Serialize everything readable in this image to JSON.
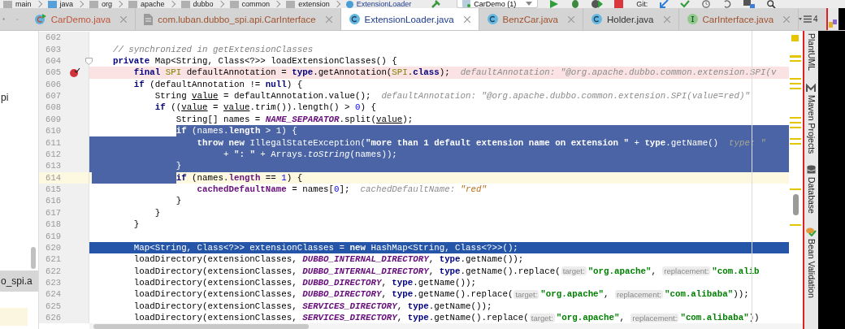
{
  "breadcrumbs": [
    {
      "text": "main",
      "kind": "folder"
    },
    {
      "text": "java",
      "kind": "source-folder"
    },
    {
      "text": "org",
      "kind": "folder"
    },
    {
      "text": "apache",
      "kind": "folder"
    },
    {
      "text": "dubbo",
      "kind": "folder"
    },
    {
      "text": "common",
      "kind": "folder"
    },
    {
      "text": "extension",
      "kind": "folder"
    },
    {
      "text": "ExtensionLoader",
      "kind": "class"
    }
  ],
  "run_config": {
    "text": "CarDemo (1)"
  },
  "vcs_label": "Git:",
  "tabs": [
    {
      "label": "CarDemo.java",
      "kind": "class-run",
      "color": "#c0563a",
      "selected": false
    },
    {
      "label": "com.luban.dubbo_spi.api.CarInterface",
      "kind": "file",
      "color": "#a0522d",
      "selected": false
    },
    {
      "label": "ExtensionLoader.java",
      "kind": "class",
      "color": "#1d3b8c",
      "selected": true
    },
    {
      "label": "BenzCar.java",
      "kind": "class",
      "color": "#a0522d",
      "selected": false
    },
    {
      "label": "Holder.java",
      "kind": "class",
      "color": "#333333",
      "selected": false
    },
    {
      "label": "CarInterface.java",
      "kind": "interface",
      "color": "#a0522d",
      "selected": false
    }
  ],
  "tab_overflow": {
    "count": "4"
  },
  "project_panel": {
    "items": [
      {
        "text": "pi",
        "selected": false
      },
      {
        "text": "o_spi.a",
        "selected": true
      }
    ]
  },
  "editor": {
    "lines": [
      {
        "number": "602",
        "kind": "code"
      },
      {
        "number": "603",
        "kind": "code",
        "tokens": [
          {
            "kind": "comment",
            "text": "// synchronized in getExtensionClasses"
          }
        ]
      },
      {
        "number": "604",
        "kind": "code",
        "foldable": true,
        "tokens": [
          {
            "kind": "keyword",
            "text": "private"
          },
          {
            "kind": "plain",
            "text": " Map<String, Class<?>> loadExtensionClasses() {"
          }
        ],
        "children": [
          {
            "number": "605",
            "kind": "breakpoint",
            "tokens": [
              {
                "kind": "keyword",
                "text": "final"
              },
              {
                "kind": "annotation",
                "text": " SPI"
              },
              {
                "kind": "plain",
                "text": " defaultAnnotation = "
              },
              {
                "kind": "keyword",
                "text": "type"
              },
              {
                "kind": "plain",
                "text": ".getAnnotation("
              },
              {
                "kind": "annotation",
                "text": "SPI"
              },
              {
                "kind": "plain",
                "text": "."
              },
              {
                "kind": "keyword",
                "text": "class"
              },
              {
                "kind": "plain",
                "text": ");  "
              },
              {
                "kind": "hint",
                "text": "defaultAnnotation: \"@org.apache.dubbo.common.extension.SPI(v"
              }
            ]
          },
          {
            "number": "606",
            "kind": "code",
            "tokens": [
              {
                "kind": "keyword",
                "text": "if"
              },
              {
                "kind": "plain",
                "text": " (defaultAnnotation != "
              },
              {
                "kind": "keyword",
                "text": "null"
              },
              {
                "kind": "plain",
                "text": ") {"
              }
            ],
            "children": [
              {
                "number": "607",
                "kind": "code",
                "tokens": [
                  {
                    "kind": "plain",
                    "text": "String "
                  },
                  {
                    "kind": "underlined",
                    "text": "value"
                  },
                  {
                    "kind": "plain",
                    "text": " = defaultAnnotation.value();  "
                  },
                  {
                    "kind": "hint",
                    "text": "defaultAnnotation: \"@org.apache.dubbo.common.extension.SPI(value=red)\""
                  }
                ]
              },
              {
                "number": "608",
                "kind": "code",
                "tokens": [
                  {
                    "kind": "keyword",
                    "text": "if"
                  },
                  {
                    "kind": "plain",
                    "text": " (("
                  },
                  {
                    "kind": "underlined",
                    "text": "value"
                  },
                  {
                    "kind": "plain",
                    "text": " = "
                  },
                  {
                    "kind": "underlined",
                    "text": "value"
                  },
                  {
                    "kind": "plain",
                    "text": ".trim()).length() > "
                  },
                  {
                    "kind": "number",
                    "text": "0"
                  },
                  {
                    "kind": "plain",
                    "text": ") {"
                  }
                ],
                "children": [
                  {
                    "number": "609",
                    "kind": "code",
                    "tokens": [
                      {
                        "kind": "plain",
                        "text": "String[] names = "
                      },
                      {
                        "kind": "constant",
                        "text": "NAME_SEPARATOR"
                      },
                      {
                        "kind": "plain",
                        "text": ".split("
                      },
                      {
                        "kind": "underlined",
                        "text": "value"
                      },
                      {
                        "kind": "plain",
                        "text": ");"
                      }
                    ]
                  },
                  {
                    "number": "610",
                    "kind": "selected-from-text",
                    "tokens": [
                      {
                        "kind": "keyword",
                        "text": "if"
                      },
                      {
                        "kind": "plain",
                        "text": " (names."
                      },
                      {
                        "kind": "field",
                        "text": "length"
                      },
                      {
                        "kind": "plain",
                        "text": " > "
                      },
                      {
                        "kind": "number",
                        "text": "1"
                      },
                      {
                        "kind": "plain",
                        "text": ") {"
                      }
                    ],
                    "children": [
                      {
                        "number": "611",
                        "kind": "selected",
                        "tokens": [
                          {
                            "kind": "keyword",
                            "text": "throw new"
                          },
                          {
                            "kind": "plain",
                            "text": " IllegalStateException("
                          },
                          {
                            "kind": "string",
                            "text": "\"more than 1 default extension name on extension \""
                          },
                          {
                            "kind": "plain",
                            "text": " + "
                          },
                          {
                            "kind": "keyword",
                            "text": "type"
                          },
                          {
                            "kind": "plain",
                            "text": ".getName()  "
                          },
                          {
                            "kind": "hint",
                            "text": "type: \""
                          }
                        ]
                      },
                      {
                        "number": "612",
                        "kind": "continuation-selected",
                        "tokens": [
                          {
                            "kind": "plain",
                            "text": "+ "
                          },
                          {
                            "kind": "string",
                            "text": "\": \""
                          },
                          {
                            "kind": "plain",
                            "text": " + Arrays."
                          },
                          {
                            "kind": "italic",
                            "text": "toString"
                          },
                          {
                            "kind": "plain",
                            "text": "(names));"
                          }
                        ]
                      }
                    ]
                  },
                  {
                    "number": "613",
                    "kind": "selected",
                    "tokens": [
                      {
                        "kind": "plain",
                        "text": "}"
                      }
                    ]
                  },
                  {
                    "number": "614",
                    "kind": "current-indent-selected",
                    "tokens": [
                      {
                        "kind": "keyword",
                        "text": "if"
                      },
                      {
                        "kind": "plain",
                        "text": " (names."
                      },
                      {
                        "kind": "field",
                        "text": "length"
                      },
                      {
                        "kind": "plain",
                        "text": " == "
                      },
                      {
                        "kind": "number",
                        "text": "1"
                      },
                      {
                        "kind": "plain",
                        "text": ") {"
                      }
                    ],
                    "children": [
                      {
                        "number": "615",
                        "kind": "code",
                        "tokens": [
                          {
                            "kind": "field",
                            "text": "cachedDefaultName"
                          },
                          {
                            "kind": "plain",
                            "text": " = names["
                          },
                          {
                            "kind": "number",
                            "text": "0"
                          },
                          {
                            "kind": "plain",
                            "text": "];  "
                          },
                          {
                            "kind": "hint",
                            "text": "cachedDefaultName: "
                          },
                          {
                            "kind": "hint-string",
                            "text": "\"red\""
                          }
                        ]
                      }
                    ]
                  },
                  {
                    "number": "616",
                    "kind": "code",
                    "tokens": [
                      {
                        "kind": "plain",
                        "text": "}"
                      }
                    ]
                  }
                ]
              },
              {
                "number": "617",
                "kind": "code",
                "tokens": [
                  {
                    "kind": "plain",
                    "text": "}"
                  }
                ]
              }
            ]
          },
          {
            "number": "618",
            "kind": "code",
            "tokens": [
              {
                "kind": "plain",
                "text": "}"
              }
            ]
          },
          {
            "number": "619",
            "kind": "code"
          },
          {
            "number": "620",
            "kind": "execution",
            "tokens": [
              {
                "kind": "plain",
                "text": "Map<String, Class<?>> extensionClasses = "
              },
              {
                "kind": "keyword",
                "text": "new"
              },
              {
                "kind": "plain",
                "text": " HashMap<String, Class<?>>();"
              }
            ]
          },
          {
            "number": "621",
            "kind": "code",
            "tokens": [
              {
                "kind": "plain",
                "text": "loadDirectory(extensionClasses, "
              },
              {
                "kind": "constant",
                "text": "DUBBO_INTERNAL_DIRECTORY"
              },
              {
                "kind": "plain",
                "text": ", "
              },
              {
                "kind": "keyword",
                "text": "type"
              },
              {
                "kind": "plain",
                "text": ".getName());"
              }
            ]
          },
          {
            "number": "622",
            "kind": "code",
            "tokens": [
              {
                "kind": "plain",
                "text": "loadDirectory(extensionClasses, "
              },
              {
                "kind": "constant",
                "text": "DUBBO_INTERNAL_DIRECTORY"
              },
              {
                "kind": "plain",
                "text": ", "
              },
              {
                "kind": "keyword",
                "text": "type"
              },
              {
                "kind": "plain",
                "text": ".getName().replace("
              },
              {
                "kind": "param",
                "text": "target:"
              },
              {
                "kind": "string",
                "text": "\"org.apache\""
              },
              {
                "kind": "plain",
                "text": ", "
              },
              {
                "kind": "param",
                "text": "replacement:"
              },
              {
                "kind": "string",
                "text": "\"com.alib"
              }
            ]
          },
          {
            "number": "623",
            "kind": "code",
            "tokens": [
              {
                "kind": "plain",
                "text": "loadDirectory(extensionClasses, "
              },
              {
                "kind": "constant",
                "text": "DUBBO_DIRECTORY"
              },
              {
                "kind": "plain",
                "text": ", "
              },
              {
                "kind": "keyword",
                "text": "type"
              },
              {
                "kind": "plain",
                "text": ".getName());"
              }
            ]
          },
          {
            "number": "624",
            "kind": "code",
            "tokens": [
              {
                "kind": "plain",
                "text": "loadDirectory(extensionClasses, "
              },
              {
                "kind": "constant",
                "text": "DUBBO_DIRECTORY"
              },
              {
                "kind": "plain",
                "text": ", "
              },
              {
                "kind": "keyword",
                "text": "type"
              },
              {
                "kind": "plain",
                "text": ".getName().replace("
              },
              {
                "kind": "param",
                "text": "target:"
              },
              {
                "kind": "string",
                "text": "\"org.apache\""
              },
              {
                "kind": "plain",
                "text": ", "
              },
              {
                "kind": "param",
                "text": "replacement:"
              },
              {
                "kind": "string",
                "text": "\"com.alibaba\""
              },
              {
                "kind": "plain",
                "text": "));"
              }
            ]
          },
          {
            "number": "625",
            "kind": "code",
            "tokens": [
              {
                "kind": "plain",
                "text": "loadDirectory(extensionClasses, "
              },
              {
                "kind": "constant",
                "text": "SERVICES_DIRECTORY"
              },
              {
                "kind": "plain",
                "text": ", "
              },
              {
                "kind": "keyword",
                "text": "type"
              },
              {
                "kind": "plain",
                "text": ".getName());"
              }
            ]
          },
          {
            "number": "626",
            "kind": "code",
            "tokens": [
              {
                "kind": "plain",
                "text": "loadDirectory(extensionClasses, "
              },
              {
                "kind": "constant",
                "text": "SERVICES_DIRECTORY"
              },
              {
                "kind": "plain",
                "text": ", "
              },
              {
                "kind": "keyword",
                "text": "type"
              },
              {
                "kind": "plain",
                "text": ".getName().replace("
              },
              {
                "kind": "param",
                "text": "target:"
              },
              {
                "kind": "string",
                "text": "\"org.apache\""
              },
              {
                "kind": "plain",
                "text": ", "
              },
              {
                "kind": "param",
                "text": "replacement:"
              },
              {
                "kind": "string",
                "text": "\"com.alibaba\""
              },
              {
                "kind": "plain",
                "text": "))"
              }
            ]
          }
        ]
      }
    ]
  },
  "tool_windows": [
    {
      "label": "PlantUML",
      "kind": "plantuml"
    },
    {
      "label": "Maven Projects",
      "kind": "maven"
    },
    {
      "label": "Database",
      "kind": "database"
    },
    {
      "label": "Bean Validation",
      "kind": "bean"
    }
  ]
}
